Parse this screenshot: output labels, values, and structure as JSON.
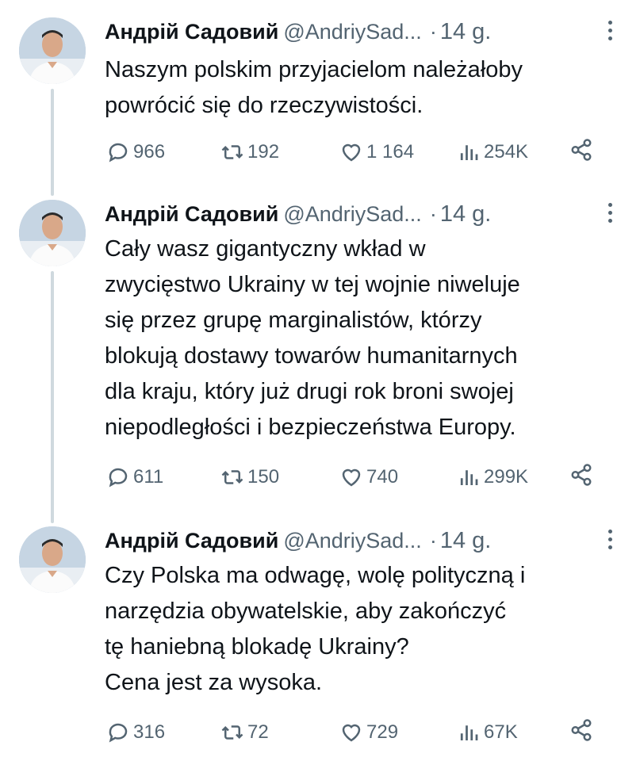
{
  "tweets": [
    {
      "author_name": "Андрій Садовий",
      "handle": "@AndriySad...",
      "separator": "·",
      "time": "14 g.",
      "lines": [
        "Naszym polskim przyjacielom należałoby",
        "powrócić się do rzeczywistości."
      ],
      "replies": "966",
      "reposts": "192",
      "likes": "1 164",
      "views": "254K"
    },
    {
      "author_name": "Андрій Садовий",
      "handle": "@AndriySad...",
      "separator": "·",
      "time": "14 g.",
      "lines": [
        "Cały wasz gigantyczny wkład w",
        "zwycięstwo Ukrainy w tej wojnie niweluje",
        "się przez grupę marginalistów, którzy",
        "blokują dostawy towarów humanitarnych",
        "dla kraju, który już drugi rok broni swojej",
        "niepodległości i bezpieczeństwa Europy."
      ],
      "replies": "611",
      "reposts": "150",
      "likes": "740",
      "views": "299K"
    },
    {
      "author_name": "Андрій Садовий",
      "handle": "@AndriySad...",
      "separator": "·",
      "time": "14 g.",
      "lines": [
        "Czy Polska ma odwagę, wolę polityczną i",
        "narzędzia obywatelskie, aby zakończyć",
        "tę haniebną blokadę Ukrainy?",
        "Cena jest za wysoka."
      ],
      "replies": "316",
      "reposts": "72",
      "likes": "729",
      "views": "67K"
    }
  ],
  "icons": {
    "reply": "reply-icon",
    "repost": "repost-icon",
    "like": "like-icon",
    "views": "views-icon",
    "share": "share-icon",
    "more": "more-icon"
  },
  "colors": {
    "text": "#0f1419",
    "secondary": "#536471",
    "thread_line": "#cfd9de"
  }
}
